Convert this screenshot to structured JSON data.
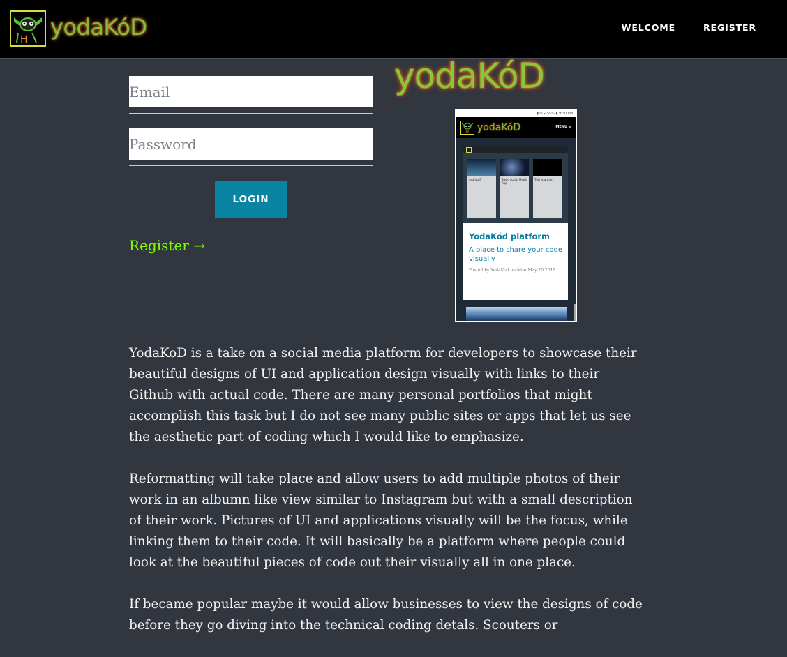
{
  "header": {
    "brand": "yodaKóD",
    "nav": [
      {
        "label": "WELCOME"
      },
      {
        "label": "REGISTER"
      }
    ]
  },
  "login_form": {
    "email_placeholder": "Email",
    "password_placeholder": "Password",
    "login_label": "LOGIN",
    "register_link": "Register →"
  },
  "hero": {
    "brand": "yodaKóD",
    "phone": {
      "status": "▮ ✉ ⌁ 55% ▮ 9:30 PM",
      "brand": "yodaKóD",
      "menu": "MENU ≡",
      "cards": [
        "asdfasdf",
        "Basic Social Media App",
        "This is a title"
      ],
      "post_title": "YodaKód platform",
      "post_subtitle": "A place to share your code visually",
      "post_meta": "Posted by YodaKod on Mon May 20 2019"
    }
  },
  "description": {
    "paragraphs": [
      "YodaKoD is a take on a social media platform for developers to showcase their beautiful designs of UI and application design visually with links to their Github with actual code. There are many personal portfolios that might accomplish this task but I do not see many public sites or apps that let us see the aesthetic part of coding which I would like to emphasize.",
      "Reformatting will take place and allow users to add multiple photos of their work in an albumn like view similar to Instagram but with a small description of their work. Pictures of UI and applications visually will be the focus, while linking them to their code. It will basically be a platform where people could look at the beautiful pieces of code out their visually all in one place.",
      "If became popular maybe it would allow businesses to view the designs of code before they go diving into the technical coding detals. Scouters or"
    ]
  },
  "colors": {
    "header_bg": "#000000",
    "page_bg": "#32363e",
    "accent_button": "#0b83a3",
    "link_green": "#7dfc00",
    "brand_green": "#78c23c"
  }
}
